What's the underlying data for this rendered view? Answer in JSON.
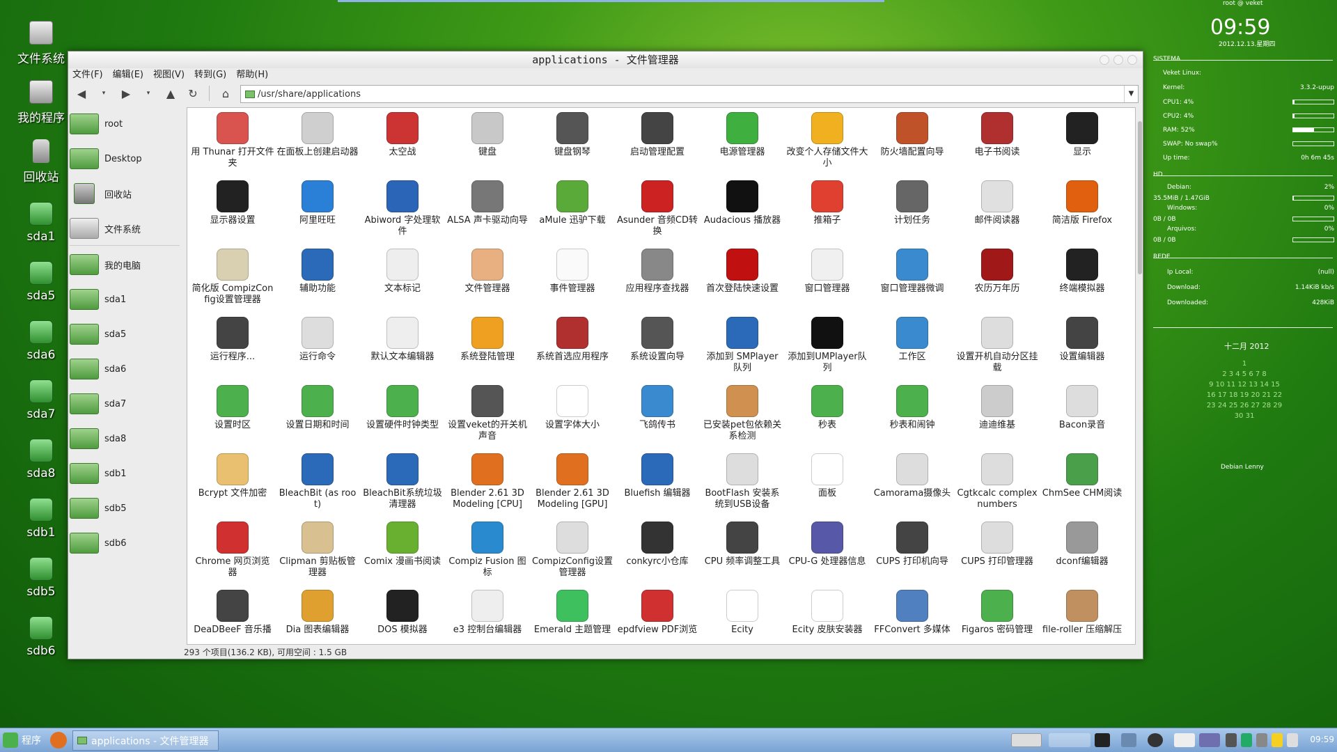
{
  "desktop": {
    "icons": [
      {
        "label": "文件系统",
        "kind": "drive"
      },
      {
        "label": "我的程序",
        "kind": "prog"
      },
      {
        "label": "回收站",
        "kind": "bin"
      },
      {
        "label": "sda1",
        "kind": "green"
      },
      {
        "label": "sda5",
        "kind": "green"
      },
      {
        "label": "sda6",
        "kind": "green"
      },
      {
        "label": "sda7",
        "kind": "green"
      },
      {
        "label": "sda8",
        "kind": "green"
      },
      {
        "label": "sdb1",
        "kind": "green"
      },
      {
        "label": "sdb5",
        "kind": "green"
      },
      {
        "label": "sdb6",
        "kind": "green"
      }
    ]
  },
  "window": {
    "title": "applications - 文件管理器",
    "menu": [
      "文件(F)",
      "编辑(E)",
      "视图(V)",
      "转到(G)",
      "帮助(H)"
    ],
    "path": "/usr/share/applications",
    "status": "293 个项目(136.2 KB), 可用空间 : 1.5 GB"
  },
  "sidebar": {
    "items": [
      {
        "label": "root",
        "kind": "green"
      },
      {
        "label": "Desktop",
        "kind": "green"
      },
      {
        "label": "回收站",
        "kind": "bin"
      },
      {
        "label": "文件系统",
        "kind": "drv"
      },
      {
        "label": "我的电脑",
        "kind": "green"
      },
      {
        "label": "sda1",
        "kind": "green"
      },
      {
        "label": "sda5",
        "kind": "green"
      },
      {
        "label": "sda6",
        "kind": "green"
      },
      {
        "label": "sda7",
        "kind": "green"
      },
      {
        "label": "sda8",
        "kind": "green"
      },
      {
        "label": "sdb1",
        "kind": "green"
      },
      {
        "label": "sdb5",
        "kind": "green"
      },
      {
        "label": "sdb6",
        "kind": "green"
      }
    ]
  },
  "apps": {
    "colors": [
      "#d9534f",
      "#cfcfcf",
      "#cc3333",
      "#c8c8c8",
      "#555",
      "#444",
      "#3fb03f",
      "#f0b020",
      "#c0522a",
      "#b03030",
      "#222",
      "#222",
      "#2a7fd6",
      "#2b65b8",
      "#777",
      "#5aaa3a",
      "#cc2222",
      "#111",
      "#e04030",
      "#666",
      "#e0e0e0",
      "#e06010",
      "#d8d0b0",
      "#2a6ab8",
      "#eee",
      "#e8b080",
      "#fafafa",
      "#888",
      "#c01010",
      "#f0f0f0",
      "#3a8ad0",
      "#a01818",
      "#222",
      "#444",
      "#ddd",
      "#eee",
      "#f0a020",
      "#b03030",
      "#555",
      "#2a6ab8",
      "#111",
      "#3a8ad0",
      "#ddd",
      "#444",
      "#4cb04c",
      "#4cb04c",
      "#4cb04c",
      "#555",
      "#fff",
      "#3a8ad0",
      "#d09050",
      "#4cb04c",
      "#4cb04c",
      "#ccc",
      "#ddd",
      "#e8c070",
      "#2a6ab8",
      "#2a6ab8",
      "#e07020",
      "#e07020",
      "#2a6ab8",
      "#ddd",
      "#fff",
      "#ddd",
      "#ddd",
      "#4aa04a",
      "#d03030",
      "#d8c090",
      "#6ab030",
      "#2a8ad0",
      "#ddd",
      "#333",
      "#444",
      "#5858a8",
      "#444",
      "#ddd",
      "#999",
      "#444",
      "#e0a030",
      "#222",
      "#eee",
      "#3fc05f",
      "#d03030",
      "#fff",
      "#fff",
      "#5080c0",
      "#4cb04c",
      "#c09060"
    ],
    "items": [
      {
        "label": "用 Thunar 打开文件夹"
      },
      {
        "label": "在面板上创建启动器"
      },
      {
        "label": "太空战"
      },
      {
        "label": "键盘"
      },
      {
        "label": "键盘钢琴"
      },
      {
        "label": "启动管理配置"
      },
      {
        "label": "电源管理器"
      },
      {
        "label": "改变个人存储文件大小"
      },
      {
        "label": "防火墙配置向导"
      },
      {
        "label": "电子书阅读"
      },
      {
        "label": "显示"
      },
      {
        "label": "显示器设置"
      },
      {
        "label": "阿里旺旺"
      },
      {
        "label": "Abiword 字处理软件"
      },
      {
        "label": "ALSA 声卡驱动向导"
      },
      {
        "label": "aMule 迅驴下载"
      },
      {
        "label": "Asunder 音频CD转换"
      },
      {
        "label": "Audacious 播放器"
      },
      {
        "label": "推箱子"
      },
      {
        "label": "计划任务"
      },
      {
        "label": "邮件阅读器"
      },
      {
        "label": "简洁版 Firefox"
      },
      {
        "label": "简化版 CompizConfig设置管理器"
      },
      {
        "label": "辅助功能"
      },
      {
        "label": "文本标记"
      },
      {
        "label": "文件管理器"
      },
      {
        "label": "事件管理器"
      },
      {
        "label": "应用程序查找器"
      },
      {
        "label": "首次登陆快速设置"
      },
      {
        "label": "窗口管理器"
      },
      {
        "label": "窗口管理器微调"
      },
      {
        "label": "农历万年历"
      },
      {
        "label": "终端模拟器"
      },
      {
        "label": "运行程序..."
      },
      {
        "label": "运行命令"
      },
      {
        "label": "默认文本编辑器"
      },
      {
        "label": "系统登陆管理"
      },
      {
        "label": "系统首选应用程序"
      },
      {
        "label": "系统设置向导"
      },
      {
        "label": "添加到 SMPlayer 队列"
      },
      {
        "label": "添加到UMPlayer队列"
      },
      {
        "label": "工作区"
      },
      {
        "label": "设置开机自动分区挂载"
      },
      {
        "label": "设置编辑器"
      },
      {
        "label": "设置时区"
      },
      {
        "label": "设置日期和时间"
      },
      {
        "label": "设置硬件时钟类型"
      },
      {
        "label": "设置veket的开关机声音"
      },
      {
        "label": "设置字体大小"
      },
      {
        "label": "飞鸽传书"
      },
      {
        "label": "已安装pet包依赖关系检测"
      },
      {
        "label": "秒表"
      },
      {
        "label": "秒表和闹钟"
      },
      {
        "label": "迪迪维基"
      },
      {
        "label": "Bacon录音"
      },
      {
        "label": "Bcrypt 文件加密"
      },
      {
        "label": "BleachBit (as root)"
      },
      {
        "label": "BleachBit系统垃圾清理器"
      },
      {
        "label": "Blender 2.61 3D Modeling [CPU]"
      },
      {
        "label": "Blender 2.61 3D Modeling [GPU]"
      },
      {
        "label": "Bluefish 编辑器"
      },
      {
        "label": "BootFlash 安装系统到USB设备"
      },
      {
        "label": "面板"
      },
      {
        "label": "Camorama摄像头"
      },
      {
        "label": "Cgtkcalc complex numbers"
      },
      {
        "label": "ChmSee CHM阅读"
      },
      {
        "label": "Chrome 网页浏览器"
      },
      {
        "label": "Clipman 剪贴板管理器"
      },
      {
        "label": "Comix 漫画书阅读"
      },
      {
        "label": "Compiz Fusion 图标"
      },
      {
        "label": "CompizConfig设置管理器"
      },
      {
        "label": "conkyrc小仓库"
      },
      {
        "label": "CPU 频率调整工具"
      },
      {
        "label": "CPU-G 处理器信息"
      },
      {
        "label": "CUPS 打印机向导"
      },
      {
        "label": "CUPS 打印管理器"
      },
      {
        "label": "dconf编辑器"
      },
      {
        "label": "DeaDBeeF 音乐播"
      },
      {
        "label": "Dia 图表编辑器"
      },
      {
        "label": "DOS 模拟器"
      },
      {
        "label": "e3 控制台编辑器"
      },
      {
        "label": "Emerald 主题管理"
      },
      {
        "label": "epdfview PDF浏览"
      },
      {
        "label": "Ecity"
      },
      {
        "label": "Ecity 皮肤安装器"
      },
      {
        "label": "FFConvert 多媒体"
      },
      {
        "label": "Figaros 密码管理"
      },
      {
        "label": "file-roller 压缩解压"
      }
    ]
  },
  "conky": {
    "user_host": "root @ veket",
    "time": "09:59",
    "date": "2012.12.13.星期四",
    "section_system": "SISTEMA",
    "os": "Veket Linux:",
    "kernel_label": "Kernel:",
    "kernel_value": "3.3.2-upup",
    "cpu1": "CPU1: 4%",
    "cpu2": "CPU2: 4%",
    "ram": "RAM: 52%",
    "swap": "SWAP: No swap%",
    "uptime_label": "Up time:",
    "uptime_value": "0h 6m 45s",
    "section_hd": "HD",
    "debian_label": "Debian:",
    "debian_pct": "2%",
    "debian_size": "35.5MiB / 1.47GiB",
    "windows_label": "Windows:",
    "windows_pct": "0%",
    "windows_size": "0B / 0B",
    "arquivos_label": "Arquivos:",
    "arquivos_pct": "0%",
    "arquivos_size": "0B / 0B",
    "section_net": "REDE",
    "ip_label": "Ip Local:",
    "ip_value": "(null)",
    "download_label": "Download:",
    "download_value": "1.14KiB kb/s",
    "downloaded_label": "Downloaded:",
    "downloaded_value": "428KiB",
    "calendar_title": "十二月 2012",
    "calendar_rows": [
      "1",
      "2 3 4 5 6 7 8",
      "9 10 11 12 13 14 15",
      "16 17 18 19 20 21 22",
      "23 24 25 26 27 28 29",
      "30 31"
    ],
    "footer": "Debian Lenny",
    "ram_level": 0.52,
    "cpu1_level": 0.04,
    "cpu2_level": 0.04,
    "debian_level": 0.02
  },
  "taskbar": {
    "start_label": "程序",
    "task_label": "applications - 文件管理器",
    "clock": "09:59"
  }
}
